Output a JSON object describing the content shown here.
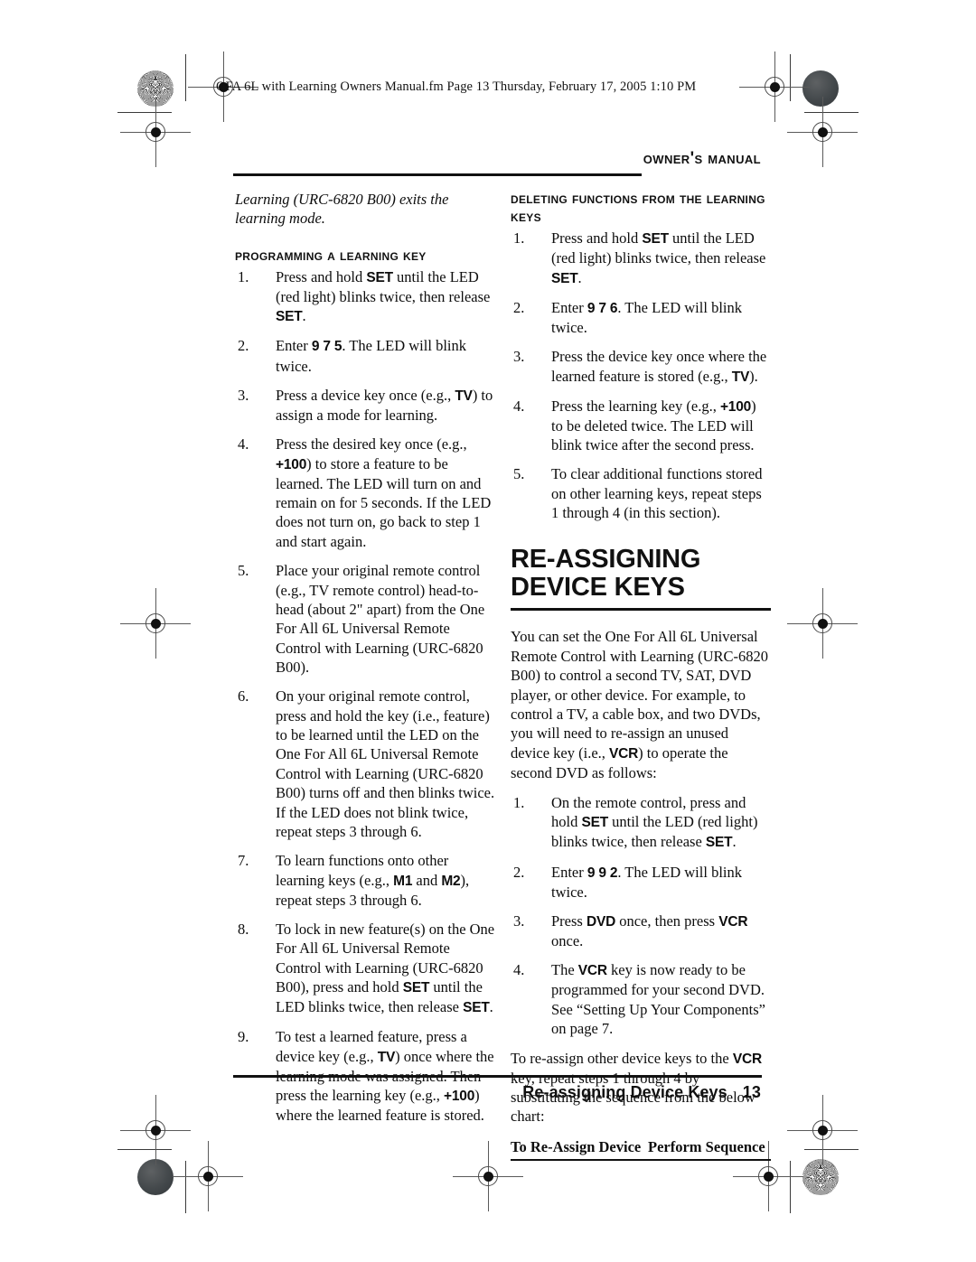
{
  "file_info": "OFA 6L with Learning Owners Manual.fm  Page 13  Thursday, February 17, 2005  1:10 PM",
  "running_head": "Owner's Manual",
  "footer": {
    "section": "Re-assigning Device Keys",
    "page_number": "13"
  },
  "left_column": {
    "intro_italic": "Learning (URC-6820 B00) exits the learning mode.",
    "section_heading": "Programming a Learning Key",
    "steps": [
      {
        "num": "1.",
        "parts": [
          {
            "t": "Press and hold ",
            "b": false
          },
          {
            "t": "SET",
            "b": true
          },
          {
            "t": " until the LED (red light) blinks twice, then release ",
            "b": false
          },
          {
            "t": "SET",
            "b": true
          },
          {
            "t": ".",
            "b": false
          }
        ]
      },
      {
        "num": "2.",
        "parts": [
          {
            "t": "Enter ",
            "b": false
          },
          {
            "t": "9 7 5",
            "b": true
          },
          {
            "t": ". The LED will blink twice.",
            "b": false
          }
        ]
      },
      {
        "num": "3.",
        "parts": [
          {
            "t": "Press a device key once (e.g., ",
            "b": false
          },
          {
            "t": "TV",
            "b": true
          },
          {
            "t": ") to assign a mode for learning.",
            "b": false
          }
        ]
      },
      {
        "num": "4.",
        "parts": [
          {
            "t": "Press the desired key once (e.g., ",
            "b": false
          },
          {
            "t": "+100",
            "b": true
          },
          {
            "t": ") to store a feature to be learned. The LED will turn on and remain on for 5 seconds. If the LED does not turn on, go back to step 1 and start again.",
            "b": false
          }
        ]
      },
      {
        "num": "5.",
        "parts": [
          {
            "t": "Place your original remote control (e.g., TV remote control) head-to-head (about 2\" apart) from the One For All 6L Universal Remote Control with Learning (URC-6820 B00).",
            "b": false
          }
        ]
      },
      {
        "num": "6.",
        "parts": [
          {
            "t": "On your original remote control, press and hold the key (i.e., feature) to be learned until the LED on the One For All 6L Universal Remote Control with Learning (URC-6820 B00) turns off and then blinks twice. If the LED does not blink twice, repeat steps 3 through 6.",
            "b": false
          }
        ]
      },
      {
        "num": "7.",
        "parts": [
          {
            "t": "To learn functions onto other learning keys (e.g., ",
            "b": false
          },
          {
            "t": "M1",
            "b": true
          },
          {
            "t": " and ",
            "b": false
          },
          {
            "t": "M2",
            "b": true
          },
          {
            "t": "), repeat steps 3 through 6.",
            "b": false
          }
        ]
      },
      {
        "num": "8.",
        "parts": [
          {
            "t": "To lock in new feature(s) on the One For All 6L Universal Remote Control with Learning (URC-6820 B00), press and hold ",
            "b": false
          },
          {
            "t": "SET",
            "b": true
          },
          {
            "t": " until the LED blinks twice, then release ",
            "b": false
          },
          {
            "t": "SET",
            "b": true
          },
          {
            "t": ".",
            "b": false
          }
        ]
      },
      {
        "num": "9.",
        "parts": [
          {
            "t": "To test a learned feature, press a device key (e.g., ",
            "b": false
          },
          {
            "t": "TV",
            "b": true
          },
          {
            "t": ") once where the learning mode was assigned. Then press the learning key (e.g., ",
            "b": false
          },
          {
            "t": "+100",
            "b": true
          },
          {
            "t": ") where the learned feature is stored.",
            "b": false
          }
        ]
      }
    ]
  },
  "right_column": {
    "section_heading": "Deleting Functions from the Learning Keys",
    "steps": [
      {
        "num": "1.",
        "parts": [
          {
            "t": "Press and hold ",
            "b": false
          },
          {
            "t": "SET",
            "b": true
          },
          {
            "t": " until the LED (red light) blinks twice, then release ",
            "b": false
          },
          {
            "t": "SET",
            "b": true
          },
          {
            "t": ".",
            "b": false
          }
        ]
      },
      {
        "num": "2.",
        "parts": [
          {
            "t": "Enter ",
            "b": false
          },
          {
            "t": "9 7 6",
            "b": true
          },
          {
            "t": ". The LED will blink twice.",
            "b": false
          }
        ]
      },
      {
        "num": "3.",
        "parts": [
          {
            "t": "Press the device key once where the learned feature is stored (e.g., ",
            "b": false
          },
          {
            "t": "TV",
            "b": true
          },
          {
            "t": ").",
            "b": false
          }
        ]
      },
      {
        "num": "4.",
        "parts": [
          {
            "t": "Press the learning key (e.g., ",
            "b": false
          },
          {
            "t": "+100",
            "b": true
          },
          {
            "t": ") to be deleted twice. The LED will blink twice after the second press.",
            "b": false
          }
        ]
      },
      {
        "num": "5.",
        "parts": [
          {
            "t": "To clear additional functions stored on other learning keys, repeat steps 1 through 4 (in this section).",
            "b": false
          }
        ]
      }
    ],
    "big_heading": "RE-ASSIGNING DEVICE KEYS",
    "intro_parts": [
      {
        "t": "You can set the One For All 6L Universal Remote Control with Learning (URC-6820 B00) to control a second TV, SAT, DVD player, or other device. For example, to control a TV, a cable box, and two DVDs, you will need to re-assign an unused device key (i.e., ",
        "b": false
      },
      {
        "t": "VCR",
        "b": true
      },
      {
        "t": ") to operate the second DVD as follows:",
        "b": false
      }
    ],
    "reassign_steps": [
      {
        "num": "1.",
        "parts": [
          {
            "t": "On the remote control, press and hold ",
            "b": false
          },
          {
            "t": "SET",
            "b": true
          },
          {
            "t": " until the LED (red light) blinks twice, then release ",
            "b": false
          },
          {
            "t": "SET",
            "b": true
          },
          {
            "t": ".",
            "b": false
          }
        ]
      },
      {
        "num": "2.",
        "parts": [
          {
            "t": "Enter ",
            "b": false
          },
          {
            "t": "9 9 2",
            "b": true
          },
          {
            "t": ". The LED will blink twice.",
            "b": false
          }
        ]
      },
      {
        "num": "3.",
        "parts": [
          {
            "t": "Press ",
            "b": false
          },
          {
            "t": "DVD",
            "b": true
          },
          {
            "t": " once, then press ",
            "b": false
          },
          {
            "t": "VCR",
            "b": true
          },
          {
            "t": " once.",
            "b": false
          }
        ]
      },
      {
        "num": "4.",
        "parts": [
          {
            "t": "The ",
            "b": false
          },
          {
            "t": "VCR",
            "b": true
          },
          {
            "t": " key is now ready to be programmed for your second DVD. See “Setting Up Your Components” on page 7.",
            "b": false
          }
        ]
      }
    ],
    "closing_parts": [
      {
        "t": "To re-assign other device keys to the ",
        "b": false
      },
      {
        "t": "VCR",
        "b": true
      },
      {
        "t": " key, repeat steps 1 through 4 by substituting the sequence from the below chart:",
        "b": false
      }
    ],
    "chart": {
      "col1_header": "To Re-Assign Device",
      "col2_header": "Perform Sequence"
    }
  }
}
